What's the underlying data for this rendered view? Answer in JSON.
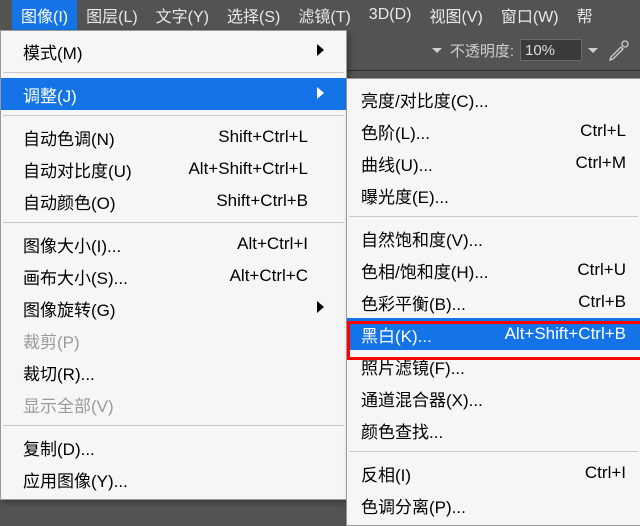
{
  "menubar": {
    "items": [
      {
        "label": "图像(I)",
        "active": true
      },
      {
        "label": "图层(L)"
      },
      {
        "label": "文字(Y)"
      },
      {
        "label": "选择(S)"
      },
      {
        "label": "滤镜(T)"
      },
      {
        "label": "3D(D)"
      },
      {
        "label": "视图(V)"
      },
      {
        "label": "窗口(W)"
      },
      {
        "label": "帮"
      }
    ]
  },
  "optionsbar": {
    "opacity_label": "不透明度:",
    "opacity_value": "10%"
  },
  "image_menu": {
    "mode": {
      "label": "模式(M)",
      "has_sub": true
    },
    "adjust": {
      "label": "调整(J)",
      "has_sub": true,
      "selected": true
    },
    "auto_tone": {
      "label": "自动色调(N)",
      "shortcut": "Shift+Ctrl+L"
    },
    "auto_contrast": {
      "label": "自动对比度(U)",
      "shortcut": "Alt+Shift+Ctrl+L"
    },
    "auto_color": {
      "label": "自动颜色(O)",
      "shortcut": "Shift+Ctrl+B"
    },
    "image_size": {
      "label": "图像大小(I)...",
      "shortcut": "Alt+Ctrl+I"
    },
    "canvas_size": {
      "label": "画布大小(S)...",
      "shortcut": "Alt+Ctrl+C"
    },
    "image_rotation": {
      "label": "图像旋转(G)",
      "has_sub": true
    },
    "crop": {
      "label": "裁剪(P)",
      "disabled": true
    },
    "trim": {
      "label": "裁切(R)..."
    },
    "reveal_all": {
      "label": "显示全部(V)",
      "disabled": true
    },
    "duplicate": {
      "label": "复制(D)..."
    },
    "apply_image": {
      "label": "应用图像(Y)..."
    }
  },
  "adjust_menu": {
    "brightcontrast": {
      "label": "亮度/对比度(C)..."
    },
    "levels": {
      "label": "色阶(L)...",
      "shortcut": "Ctrl+L"
    },
    "curves": {
      "label": "曲线(U)...",
      "shortcut": "Ctrl+M"
    },
    "exposure": {
      "label": "曝光度(E)..."
    },
    "vibrance": {
      "label": "自然饱和度(V)..."
    },
    "huesat": {
      "label": "色相/饱和度(H)...",
      "shortcut": "Ctrl+U"
    },
    "colorbalance": {
      "label": "色彩平衡(B)...",
      "shortcut": "Ctrl+B"
    },
    "blackwhite": {
      "label": "黑白(K)...",
      "shortcut": "Alt+Shift+Ctrl+B",
      "highlight": true
    },
    "photofilter": {
      "label": "照片滤镜(F)..."
    },
    "channelmixer": {
      "label": "通道混合器(X)..."
    },
    "colorlookup": {
      "label": "颜色查找..."
    },
    "invert": {
      "label": "反相(I)",
      "shortcut": "Ctrl+I"
    },
    "posterize": {
      "label": "色调分离(P)..."
    }
  }
}
